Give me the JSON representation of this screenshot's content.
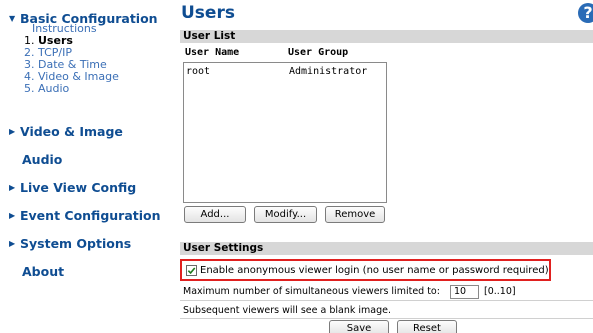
{
  "sidebar": {
    "basic_configuration": "Basic Configuration",
    "instructions": "Instructions",
    "sub_items": [
      {
        "num": "1.",
        "label": "Users"
      },
      {
        "num": "2.",
        "label": "TCP/IP"
      },
      {
        "num": "3.",
        "label": "Date & Time"
      },
      {
        "num": "4.",
        "label": "Video & Image"
      },
      {
        "num": "5.",
        "label": "Audio"
      }
    ],
    "video_image": "Video & Image",
    "audio": "Audio",
    "live_view_config": "Live View Config",
    "event_configuration": "Event Configuration",
    "system_options": "System Options",
    "about": "About"
  },
  "main": {
    "title": "Users",
    "help_glyph": "?",
    "user_list": {
      "header": "User List",
      "columns": [
        "User Name",
        "User Group"
      ],
      "rows": [
        {
          "name": "root",
          "group": "Administrator"
        }
      ],
      "buttons": {
        "add": "Add...",
        "modify": "Modify...",
        "remove": "Remove"
      }
    },
    "user_settings": {
      "header": "User Settings",
      "anonymous_login": {
        "label": "Enable anonymous viewer login (no user name or password required)",
        "checked": true
      },
      "max_viewers": {
        "label": "Maximum number of simultaneous viewers limited to:",
        "value": "10",
        "range": "[0..10]"
      },
      "subsequent_note": "Subsequent viewers will see a blank image."
    },
    "buttons": {
      "save": "Save",
      "reset": "Reset"
    }
  },
  "colors": {
    "nav_link": "#0f4d92",
    "sub_link": "#3b6fb6",
    "section_header_bg": "#d7d7d7",
    "highlight_border": "#e0201f"
  }
}
